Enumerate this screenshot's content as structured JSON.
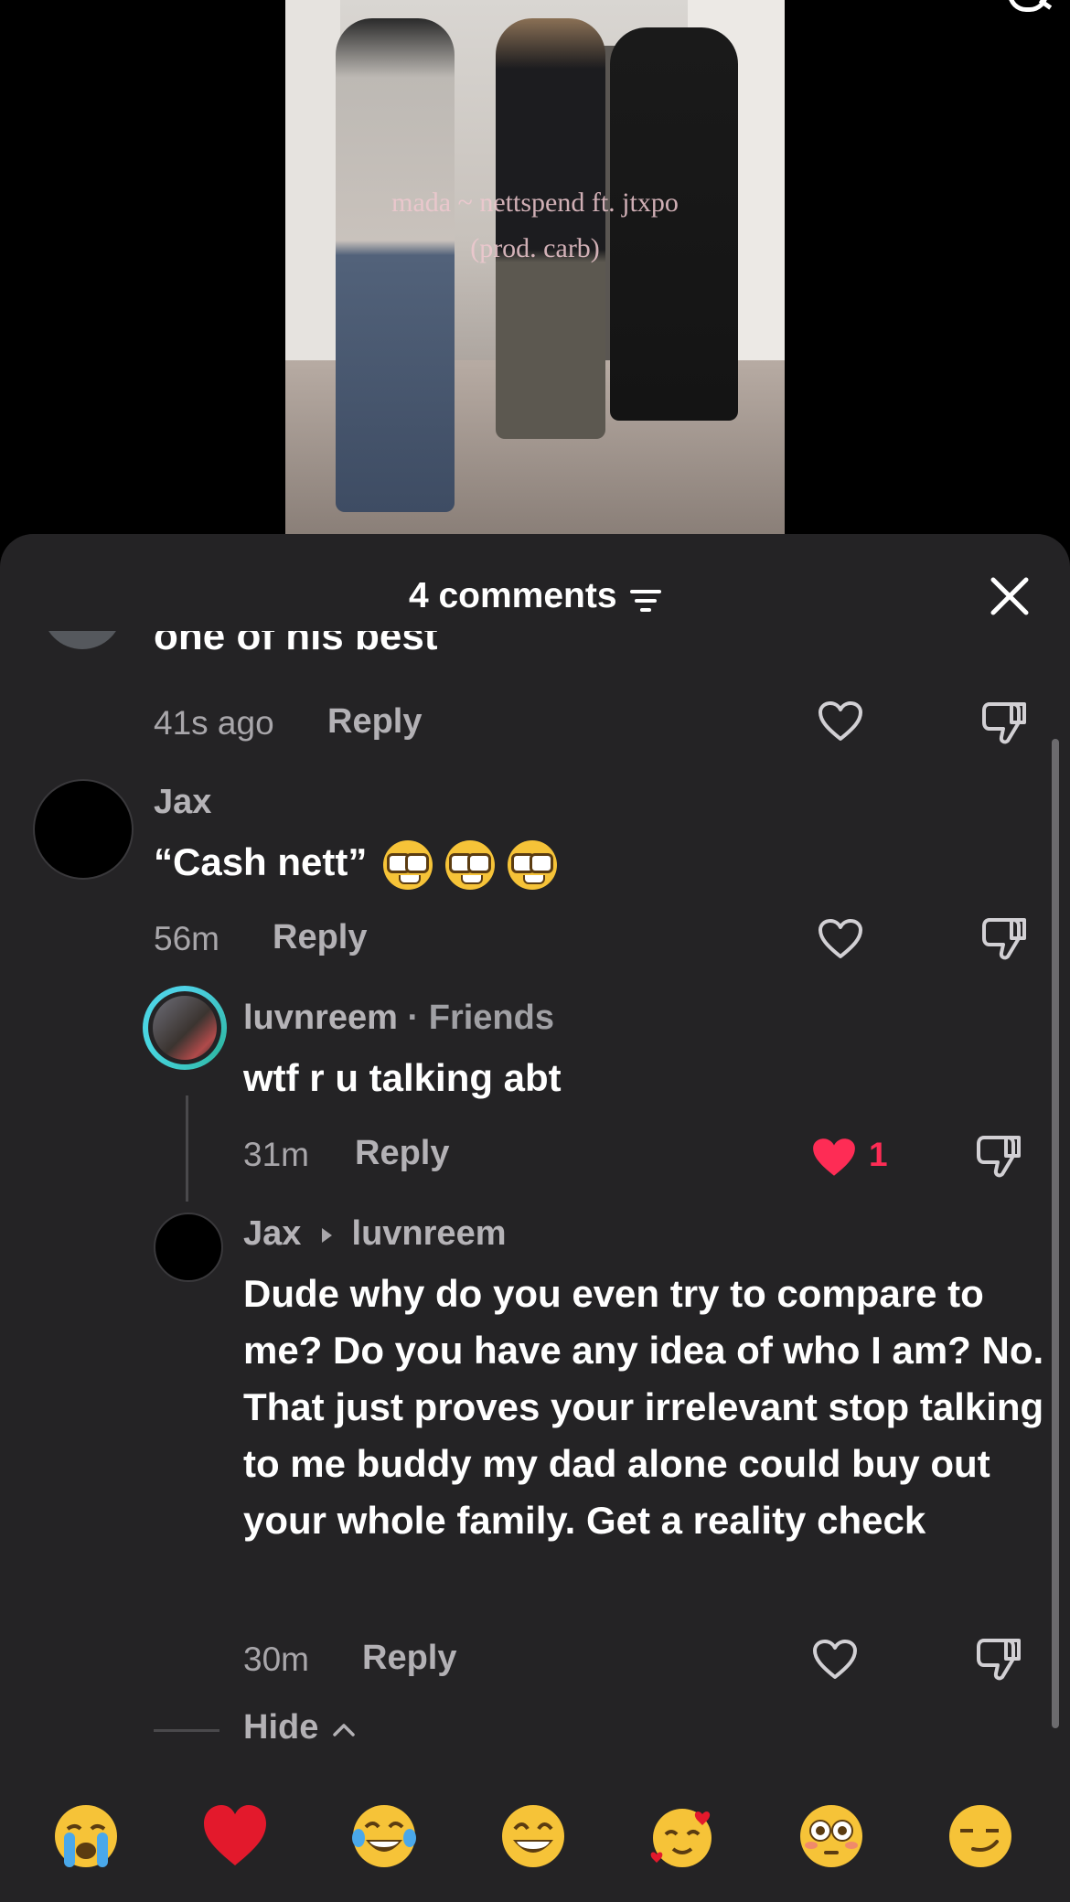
{
  "video": {
    "overlay_line1": "mada ~ nettspend ft. jtxpo",
    "overlay_line2": "(prod. carb)"
  },
  "header": {
    "title": "4 comments"
  },
  "comments": [
    {
      "text": "one of his best",
      "time": "41s ago",
      "reply": "Reply"
    },
    {
      "name": "Jax",
      "text": "“Cash nett”",
      "time": "56m",
      "reply": "Reply",
      "emojis": [
        "nerd-face-emoji",
        "nerd-face-emoji",
        "nerd-face-emoji"
      ]
    }
  ],
  "replies": [
    {
      "name": "luvnreem",
      "tag": " · Friends",
      "text": "wtf r u talking abt",
      "time": "31m",
      "reply": "Reply",
      "likes": "1"
    },
    {
      "name": "Jax",
      "to": "luvnreem",
      "text": "Dude why do you even try to compare to me? Do you have any idea of who I am? No. That just proves your irrelevant stop talking to me buddy my dad alone could buy out your whole family. Get a reality check",
      "time": "30m",
      "reply": "Reply"
    }
  ],
  "hide_label": "Hide",
  "reactions": [
    "loudly-crying-face",
    "red-heart",
    "tears-of-joy",
    "grinning-face",
    "smiling-face-with-hearts",
    "flushed-face",
    "smirking-face"
  ],
  "colors": {
    "sheet_bg": "#242325",
    "liked_heart": "#fe2c55",
    "text_muted": "#a8a6aa"
  }
}
